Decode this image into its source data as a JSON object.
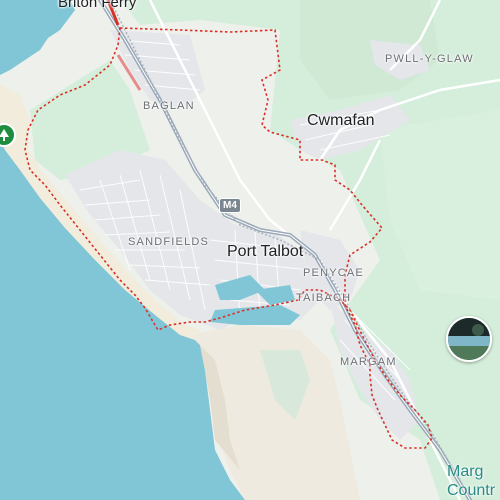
{
  "map": {
    "colors": {
      "sea": "#80c6d6",
      "land": "#eef0ec",
      "park": "#d5eedb",
      "urban": "#e5e6e9",
      "motorway": "#9aa8b7",
      "boundary": "#d93025",
      "beach": "#f1ecdc"
    },
    "labels": {
      "briton_ferry": "Briton Ferry",
      "pwll_y_glaw": "PWLL-Y-GLAW",
      "baglan": "BAGLAN",
      "cwmafan": "Cwmafan",
      "sandfields": "SANDFIELDS",
      "port_talbot": "Port Talbot",
      "penycae": "PENYCAE",
      "taibach": "TAIBACH",
      "margam": "MARGAM",
      "margam_country_1": "Marg",
      "margam_country_2": "Countr"
    },
    "road_shield": "M4",
    "icons": {
      "park_pin": "park-marker-icon",
      "photo_thumb": "photo-thumbnail"
    }
  }
}
